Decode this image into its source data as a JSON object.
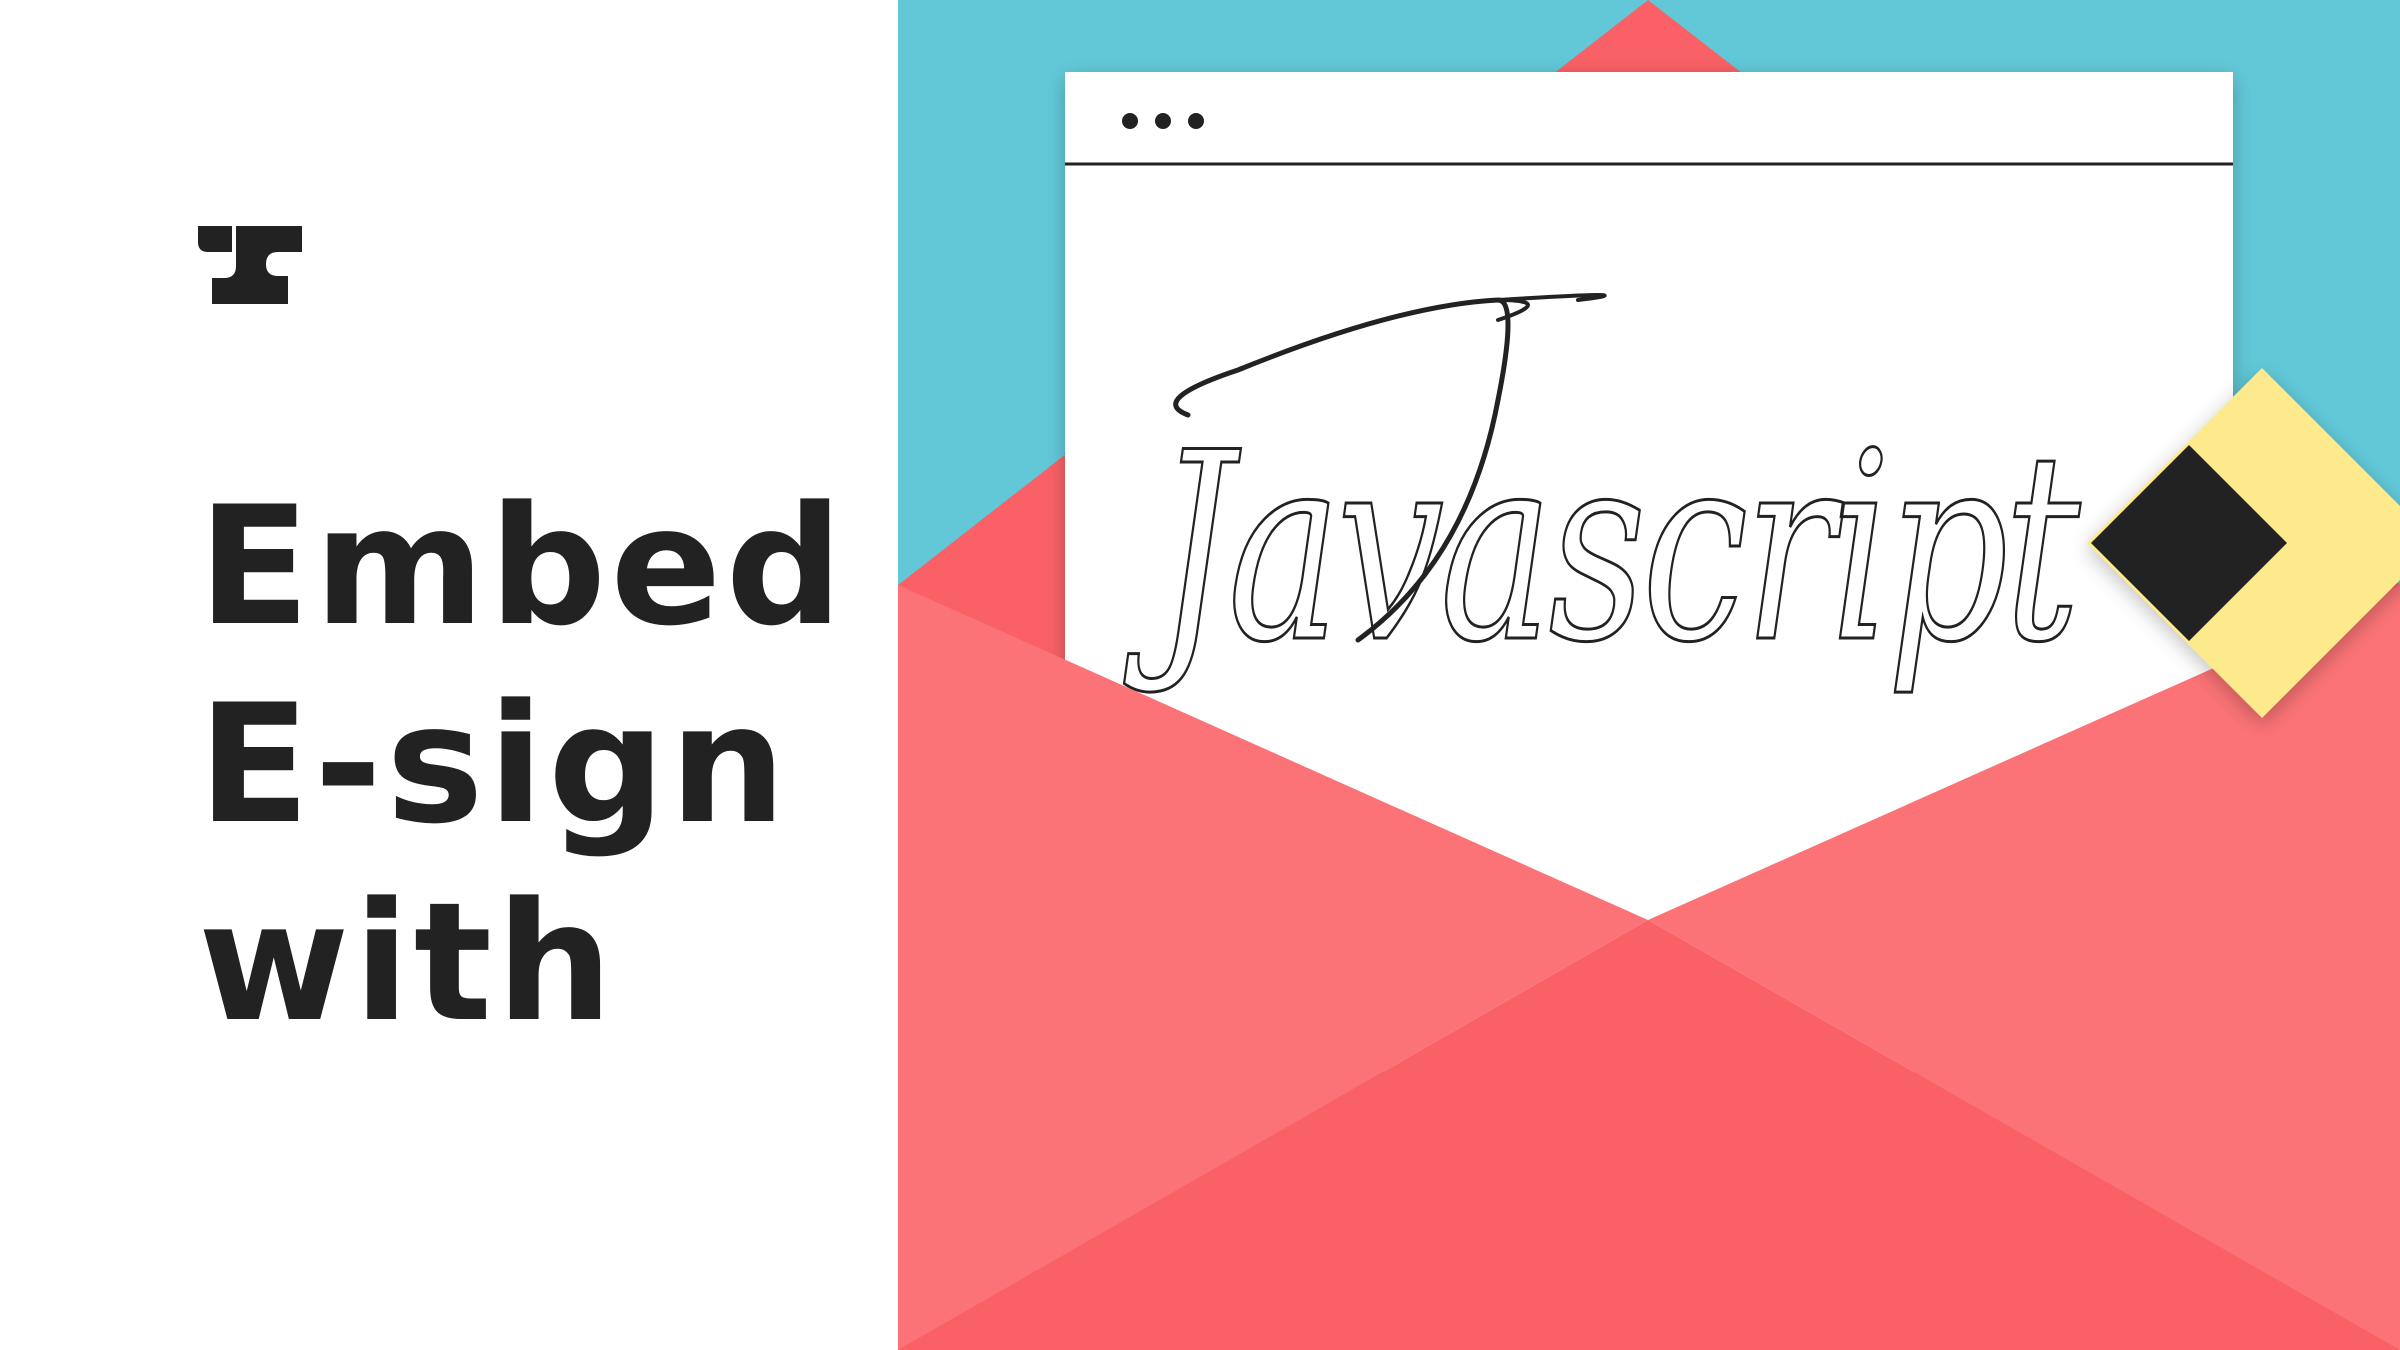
{
  "headline": {
    "line_1": "Embed",
    "line_2": "E-sign",
    "line_3": "with"
  },
  "signature": {
    "text": "Javascript"
  },
  "browser_window": {
    "dots": [
      "dot",
      "dot",
      "dot"
    ]
  },
  "icons": {
    "brand_logo": "brand-logo-icon",
    "javascript_logo": "javascript-diamond-logo-icon"
  },
  "colors": {
    "background": "#ffffff",
    "text_dark": "#222222",
    "sky_teal": "#62c8d7",
    "envelope_coral": "#f96166",
    "envelope_light_coral": "#fb7376",
    "diamond_yellow": "#fcea8c",
    "diamond_dark": "#232323"
  }
}
